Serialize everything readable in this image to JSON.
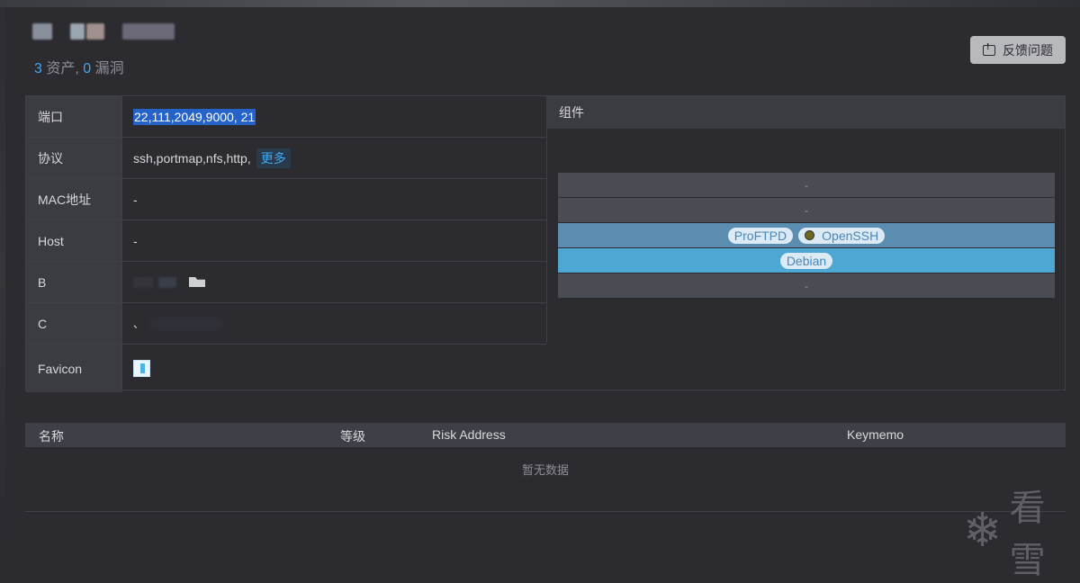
{
  "header": {
    "summary": {
      "asset_count": "3",
      "asset_label": "资产,",
      "vuln_count": "0",
      "vuln_label": "漏洞"
    },
    "feedback_label": "反馈问题"
  },
  "info": {
    "rows": [
      {
        "label": "端口",
        "value": "22,111,2049,9000, 21"
      },
      {
        "label": "协议",
        "value": "ssh,portmap,nfs,http,",
        "more": "更多"
      },
      {
        "label": "MAC地址",
        "value": "-"
      },
      {
        "label": "Host",
        "value": "-"
      },
      {
        "label": "B",
        "value": ""
      },
      {
        "label": "C",
        "value": "、"
      },
      {
        "label": "Favicon",
        "value": ""
      }
    ]
  },
  "components": {
    "title": "组件",
    "rows": [
      {
        "text": "-"
      },
      {
        "text": "-"
      },
      {
        "pills": [
          "ProFTPD",
          "OpenSSH"
        ]
      },
      {
        "pills": [
          "Debian"
        ]
      },
      {
        "text": "-"
      }
    ]
  },
  "vulns": {
    "columns": [
      "名称",
      "等级",
      "Risk Address",
      "Keymemo"
    ],
    "empty_text": "暂无数据"
  },
  "watermark": {
    "text": "看雪",
    "icon": "snowflake-icon"
  },
  "colors": {
    "accent": "#3fa9f5",
    "background": "#2b2b30",
    "row_highlight_1": "#5b8db0",
    "row_highlight_2": "#4ea7d3"
  }
}
